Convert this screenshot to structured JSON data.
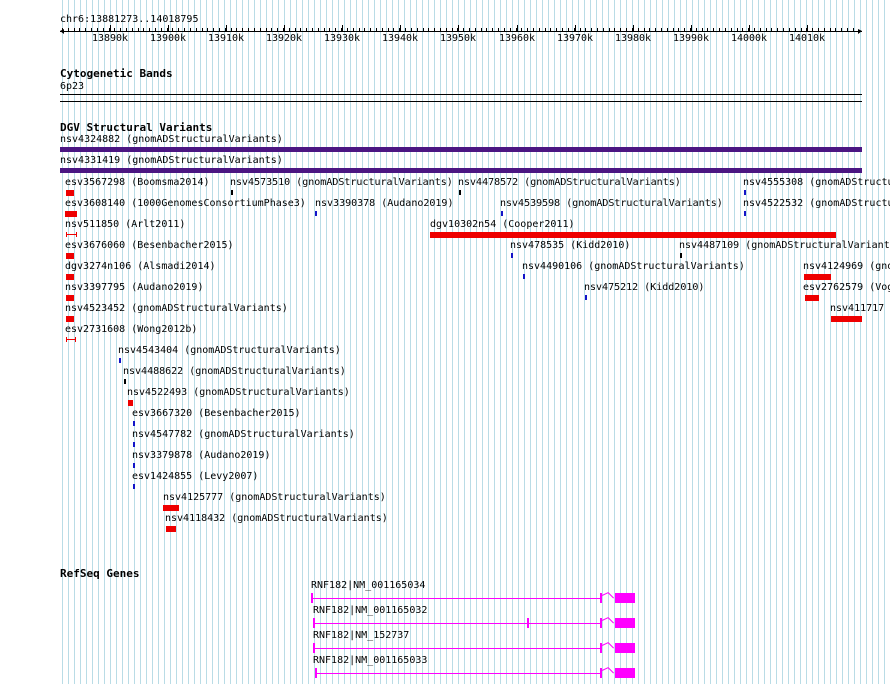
{
  "colors": {
    "grid": "#b9dce6",
    "gnomad_bar": "#4b1682",
    "loss": "#ee0000",
    "gain": "#1414c8",
    "complex": "#000000",
    "gene": "#ff00ff"
  },
  "ruler": {
    "coordinate_label": "chr6:13881273..14018795",
    "ticks": [
      "13890k",
      "13900k",
      "13910k",
      "13920k",
      "13930k",
      "13940k",
      "13950k",
      "13960k",
      "13970k",
      "13980k",
      "13990k",
      "14000k",
      "14010k"
    ]
  },
  "cytobands": {
    "title": "Cytogenetic Bands",
    "band": "6p23"
  },
  "dgv": {
    "title": "DGV Structural Variants",
    "top_labels": [
      "nsv4324882 (gnomADStructuralVariants)",
      "nsv4331419 (gnomADStructuralVariants)"
    ],
    "variants": [
      "esv3567298 (Boomsma2014)",
      "nsv4573510 (gnomADStructuralVariants)",
      "nsv4478572 (gnomADStructuralVariants)",
      "nsv4555308 (gnomADStructu",
      "esv3608140 (1000GenomesConsortiumPhase3)",
      "nsv3390378 (Audano2019)",
      "nsv4539598 (gnomADStructuralVariants)",
      "nsv4522532 (gnomADStructu",
      "nsv511850 (Arlt2011)",
      "dgv10302n54 (Cooper2011)",
      "esv3676060 (Besenbacher2015)",
      "nsv478535 (Kidd2010)",
      "nsv4487109 (gnomADStructuralVariants",
      "dgv3274n106 (Alsmadi2014)",
      "nsv4490106 (gnomADStructuralVariants)",
      "nsv4124969 (gno",
      "nsv3397795 (Audano2019)",
      "nsv475212 (Kidd2010)",
      "esv2762579 (Vog",
      "nsv4523452 (gnomADStructuralVariants)",
      "nsv411717",
      "esv2731608 (Wong2012b)",
      "nsv4543404 (gnomADStructuralVariants)",
      "nsv4488622 (gnomADStructuralVariants)",
      "nsv4522493 (gnomADStructuralVariants)",
      "esv3667320 (Besenbacher2015)",
      "nsv4547782 (gnomADStructuralVariants)",
      "nsv3379878 (Audano2019)",
      "esv1424855 (Levy2007)",
      "nsv4125777 (gnomADStructuralVariants)",
      "nsv4118432 (gnomADStructuralVariants)"
    ]
  },
  "refseq": {
    "title": "RefSeq Genes",
    "transcripts": [
      "RNF182|NM_001165034",
      "RNF182|NM_001165032",
      "RNF182|NM_152737",
      "RNF182|NM_001165033"
    ]
  }
}
